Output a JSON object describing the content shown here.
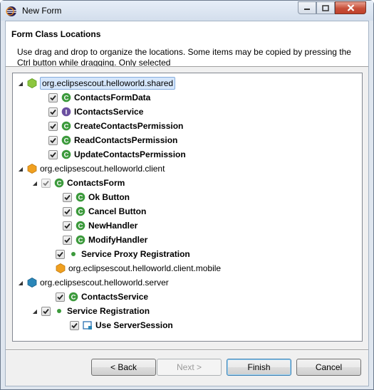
{
  "window": {
    "title": "New Form"
  },
  "header": {
    "title": "Form Class Locations",
    "description": "Use drag and drop to organize the locations. Some items may be copied by pressing the Ctrl button while dragging. Only selected"
  },
  "tree": {
    "rows": [
      {
        "label": "org.eclipsescout.helloworld.shared",
        "icon": "shared-bundle-icon",
        "twisty": "expanded",
        "checkbox": null,
        "bold": false,
        "selected": true
      },
      {
        "label": "ContactsFormData",
        "icon": "class-icon",
        "twisty": null,
        "checkbox": "checked",
        "bold": true
      },
      {
        "label": "IContactsService",
        "icon": "interface-icon",
        "twisty": null,
        "checkbox": "checked",
        "bold": true
      },
      {
        "label": "CreateContactsPermission",
        "icon": "class-icon",
        "twisty": null,
        "checkbox": "checked",
        "bold": true
      },
      {
        "label": "ReadContactsPermission",
        "icon": "class-icon",
        "twisty": null,
        "checkbox": "checked",
        "bold": true
      },
      {
        "label": "UpdateContactsPermission",
        "icon": "class-icon",
        "twisty": null,
        "checkbox": "checked",
        "bold": true
      },
      {
        "label": "org.eclipsescout.helloworld.client",
        "icon": "client-bundle-icon",
        "twisty": "expanded",
        "checkbox": null,
        "bold": false
      },
      {
        "label": "ContactsForm",
        "icon": "class-icon",
        "twisty": "expanded",
        "checkbox": "checked-gray",
        "bold": true
      },
      {
        "label": "Ok Button",
        "icon": "class-icon",
        "twisty": null,
        "checkbox": "checked",
        "bold": true
      },
      {
        "label": "Cancel Button",
        "icon": "class-icon",
        "twisty": null,
        "checkbox": "checked",
        "bold": true
      },
      {
        "label": "NewHandler",
        "icon": "class-icon",
        "twisty": null,
        "checkbox": "checked",
        "bold": true
      },
      {
        "label": "ModifyHandler",
        "icon": "class-icon",
        "twisty": null,
        "checkbox": "checked",
        "bold": true
      },
      {
        "label": "Service Proxy Registration",
        "icon": "registration-dot-icon",
        "twisty": null,
        "checkbox": "checked",
        "bold": true
      },
      {
        "label": "org.eclipsescout.helloworld.client.mobile",
        "icon": "client-bundle-icon",
        "twisty": null,
        "checkbox": null,
        "bold": false
      },
      {
        "label": "org.eclipsescout.helloworld.server",
        "icon": "server-bundle-icon",
        "twisty": "expanded",
        "checkbox": null,
        "bold": false
      },
      {
        "label": "ContactsService",
        "icon": "class-icon",
        "twisty": null,
        "checkbox": "checked",
        "bold": true
      },
      {
        "label": "Service Registration",
        "icon": "registration-dot-icon",
        "twisty": "expanded",
        "checkbox": "checked",
        "bold": true
      },
      {
        "label": "Use ServerSession",
        "icon": "server-session-icon",
        "twisty": null,
        "checkbox": "checked",
        "bold": true
      }
    ]
  },
  "buttons": {
    "back": "< Back",
    "next": "Next >",
    "finish": "Finish",
    "cancel": "Cancel"
  },
  "colors": {
    "class_green": "#3c9a3c",
    "interface_purple": "#6b4fa0",
    "client_orange": "#f0a020",
    "shared_green": "#8cc63f",
    "server_blue": "#2a86b8",
    "selection": "#d5e6fb"
  }
}
